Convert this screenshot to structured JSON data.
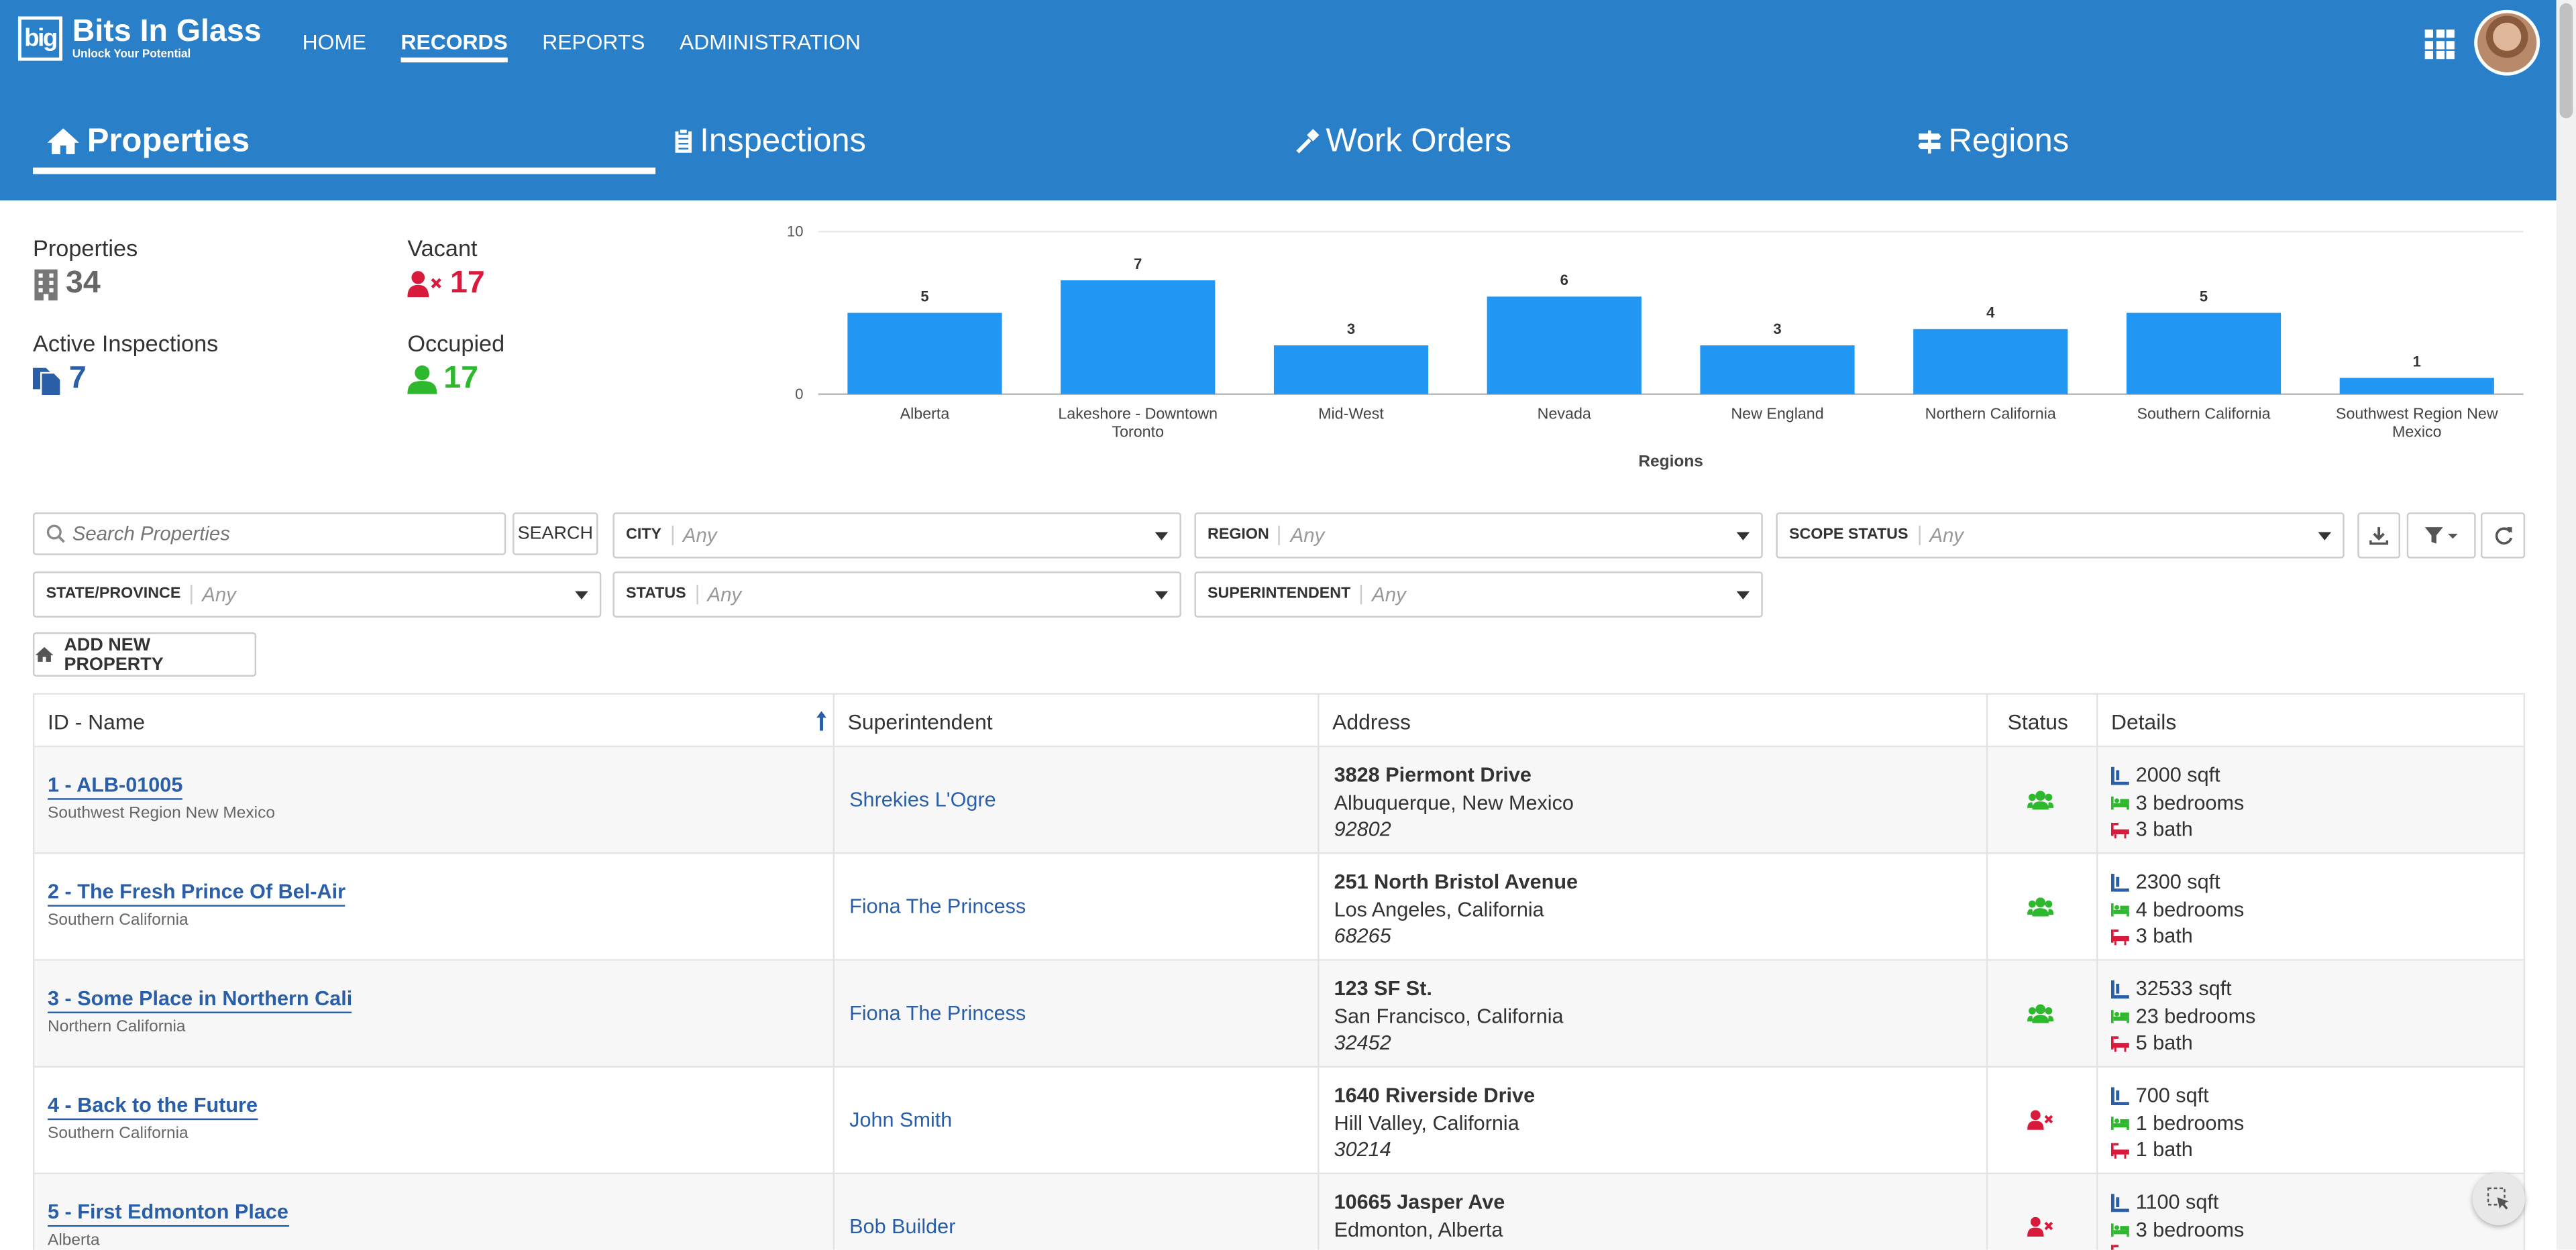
{
  "app": {
    "brand_logo": "big",
    "brand_name": "Bits In Glass",
    "brand_tagline": "Unlock Your Potential"
  },
  "topnav": [
    {
      "label": "HOME"
    },
    {
      "label": "RECORDS",
      "active": true
    },
    {
      "label": "REPORTS"
    },
    {
      "label": "ADMINISTRATION"
    }
  ],
  "tabs": [
    {
      "label": "Properties",
      "icon": "home-icon",
      "active": true
    },
    {
      "label": "Inspections",
      "icon": "clipboard-icon"
    },
    {
      "label": "Work Orders",
      "icon": "hammer-icon"
    },
    {
      "label": "Regions",
      "icon": "signpost-icon"
    }
  ],
  "stats": {
    "properties": {
      "label": "Properties",
      "value": "34"
    },
    "vacant": {
      "label": "Vacant",
      "value": "17"
    },
    "active_inspections": {
      "label": "Active Inspections",
      "value": "7"
    },
    "occupied": {
      "label": "Occupied",
      "value": "17"
    }
  },
  "chart_data": {
    "type": "bar",
    "categories": [
      "Alberta",
      "Lakeshore - Downtown Toronto",
      "Mid-West",
      "Nevada",
      "New England",
      "Northern California",
      "Southern California",
      "Southwest Region New Mexico"
    ],
    "values": [
      5,
      7,
      3,
      6,
      3,
      4,
      5,
      1
    ],
    "xlabel": "Regions",
    "ylabel": "",
    "ylim": [
      0,
      10
    ],
    "yticks": [
      0,
      10
    ],
    "color": "#2196f3",
    "grid": true
  },
  "search": {
    "placeholder": "Search Properties",
    "button": "SEARCH"
  },
  "filters": {
    "city": {
      "label": "CITY",
      "value": "Any"
    },
    "region": {
      "label": "REGION",
      "value": "Any"
    },
    "scope_status": {
      "label": "SCOPE STATUS",
      "value": "Any"
    },
    "state": {
      "label": "STATE/PROVINCE",
      "value": "Any"
    },
    "status": {
      "label": "STATUS",
      "value": "Any"
    },
    "superintendent": {
      "label": "SUPERINTENDENT",
      "value": "Any"
    }
  },
  "add_button": "ADD NEW PROPERTY",
  "table": {
    "columns": [
      "ID - Name",
      "Superintendent",
      "Address",
      "Status",
      "Details"
    ],
    "rows": [
      {
        "name": "1 - ALB-01005",
        "region": "Southwest Region New Mexico",
        "superintendent": "Shrekies L'Ogre",
        "street": "3828 Piermont Drive",
        "city": "Albuquerque, New Mexico",
        "zip": "92802",
        "status": "occupied",
        "sqft": "2000 sqft",
        "bedrooms": "3 bedrooms",
        "bath": "3 bath"
      },
      {
        "name": "2 - The Fresh Prince Of Bel-Air",
        "region": "Southern California",
        "superintendent": "Fiona The Princess",
        "street": "251 North Bristol Avenue",
        "city": "Los Angeles, California",
        "zip": "68265",
        "status": "occupied",
        "sqft": "2300 sqft",
        "bedrooms": "4 bedrooms",
        "bath": "3 bath"
      },
      {
        "name": "3 - Some Place in Northern Cali",
        "region": "Northern California",
        "superintendent": "Fiona The Princess",
        "street": "123 SF St.",
        "city": "San Francisco, California",
        "zip": "32452",
        "status": "occupied",
        "sqft": "32533 sqft",
        "bedrooms": "23 bedrooms",
        "bath": "5 bath"
      },
      {
        "name": "4 - Back to the Future",
        "region": "Southern California",
        "superintendent": "John Smith",
        "street": "1640 Riverside Drive",
        "city": "Hill Valley, California",
        "zip": "30214",
        "status": "vacant",
        "sqft": "700 sqft",
        "bedrooms": "1 bedrooms",
        "bath": "1 bath"
      },
      {
        "name": "5 -  First Edmonton Place",
        "region": "Alberta",
        "superintendent": "Bob Builder",
        "street": "10665 Jasper Ave",
        "city": "Edmonton, Alberta",
        "zip": "",
        "status": "vacant",
        "sqft": "1100 sqft",
        "bedrooms": "3 bedrooms",
        "bath": ""
      }
    ]
  },
  "colors": {
    "header": "#2a7fc9",
    "bar": "#2196f3",
    "link": "#2a5fa8",
    "occupied": "#2eb82e",
    "vacant": "#d81b3c"
  }
}
